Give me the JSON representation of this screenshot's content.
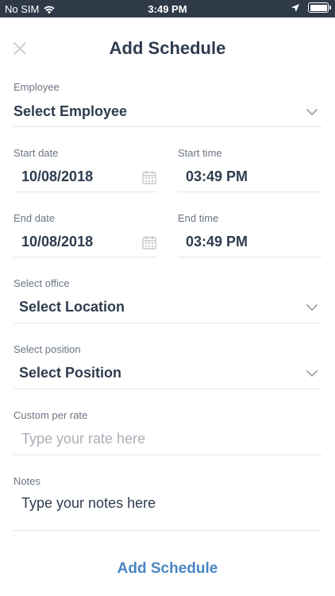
{
  "status_bar": {
    "carrier": "No SIM",
    "time": "3:49 PM"
  },
  "header": {
    "title": "Add Schedule",
    "close_icon": "close-icon"
  },
  "form": {
    "employee": {
      "label": "Employee",
      "value": "Select Employee"
    },
    "start_date": {
      "label": "Start date",
      "value": "10/08/2018"
    },
    "start_time": {
      "label": "Start time",
      "value": "03:49 PM"
    },
    "end_date": {
      "label": "End date",
      "value": "10/08/2018"
    },
    "end_time": {
      "label": "End time",
      "value": "03:49 PM"
    },
    "office": {
      "label": "Select office",
      "value": "Select Location"
    },
    "position": {
      "label": "Select position",
      "value": "Select Position"
    },
    "rate": {
      "label": "Custom per rate",
      "placeholder": "Type your rate here"
    },
    "notes": {
      "label": "Notes",
      "placeholder": "Type your notes here"
    }
  },
  "submit_label": "Add Schedule",
  "colors": {
    "status_bar_bg": "#2f3a48",
    "text_primary": "#2f3c4f",
    "label": "#6b7583",
    "accent": "#4a86c5"
  }
}
